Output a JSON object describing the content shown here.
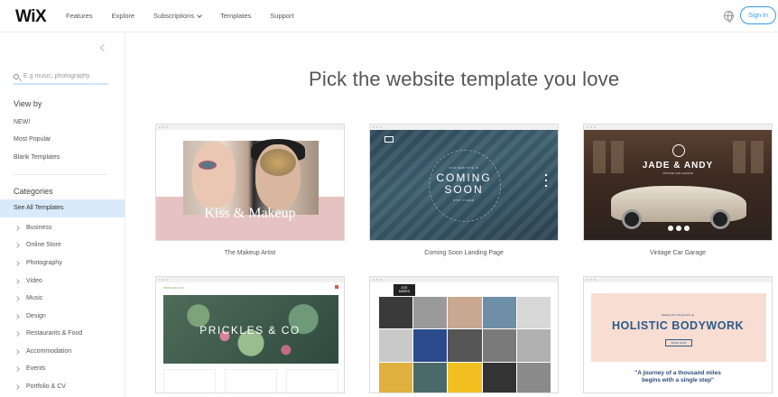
{
  "header": {
    "logo": "WiX",
    "nav": [
      "Features",
      "Explore",
      "Subscriptions",
      "Templates",
      "Support"
    ],
    "signin_label": "Sign In",
    "globe_icon": "globe-icon"
  },
  "sidebar": {
    "search_placeholder": "E.g music, photography",
    "view_by_heading": "View by",
    "view_by": [
      "NEW!",
      "Most Popular",
      "Blank Templates"
    ],
    "categories_heading": "Categories",
    "active_category": "See All Templates",
    "categories": [
      "Business",
      "Online Store",
      "Photography",
      "Video",
      "Music",
      "Design",
      "Restaurants & Food",
      "Accommodation",
      "Events",
      "Portfolio & CV"
    ]
  },
  "main": {
    "headline": "Pick the website template you love",
    "templates": [
      {
        "caption": "The Makeup Artist",
        "thumb_title": "Kiss & Makeup"
      },
      {
        "caption": "Coming Soon Landing Page",
        "thumb_small": "OUR NEW SITE IS",
        "thumb_title_1": "COMING",
        "thumb_title_2": "SOON",
        "thumb_small_2": "STAY TUNED"
      },
      {
        "caption": "Vintage Car Garage",
        "thumb_title": "JADE & ANDY",
        "thumb_sub": "VINTAGE CAR GARAGE"
      },
      {
        "caption": "",
        "thumb_title": "PRICKLES & CO",
        "thumb_head": "PRICKLES & CO."
      },
      {
        "caption": "",
        "thumb_logo_1": "ZOE",
        "thumb_logo_2": "MARKS"
      },
      {
        "caption": "",
        "thumb_small": "Healing from the ground up",
        "thumb_title": "HOLISTIC BODYWORK",
        "thumb_btn": "BOOK NOW",
        "thumb_quote_1": "\"A journey of a thousand miles",
        "thumb_quote_2": "begins with a single step\""
      }
    ]
  },
  "colors": {
    "accent": "#3899ec",
    "active_category_bg": "#d9ebfb"
  }
}
